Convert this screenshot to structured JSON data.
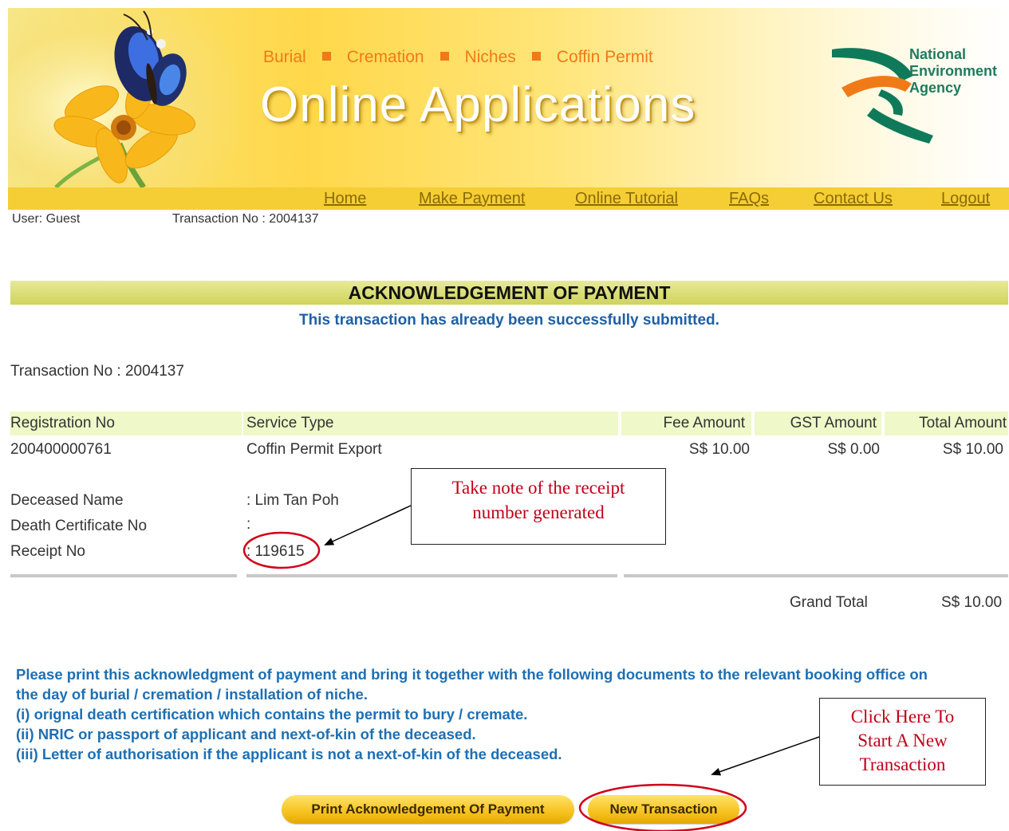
{
  "banner": {
    "subnav": [
      "Burial",
      "Cremation",
      "Niches",
      "Coffin Permit"
    ],
    "title": "Online Applications",
    "agency_lines": [
      "National",
      "Environment",
      "Agency"
    ]
  },
  "nav": {
    "home": "Home",
    "make_payment": "Make Payment",
    "online_tutorial": "Online Tutorial",
    "faqs": "FAQs",
    "contact_us": "Contact Us",
    "logout": "Logout"
  },
  "status": {
    "user_label": "User: ",
    "user_value": "Guest",
    "transaction_label": "Transaction No : 2004137"
  },
  "acknowledgement": {
    "title": "ACKNOWLEDGEMENT OF PAYMENT",
    "message": "This transaction has already been successfully submitted.",
    "transaction_line": "Transaction No : 2004137"
  },
  "table": {
    "headers": [
      "Registration No",
      "Service Type",
      "Fee Amount",
      "GST Amount",
      "Total Amount"
    ],
    "row": [
      "200400000761",
      "Coffin Permit Export",
      "S$ 10.00",
      "S$ 0.00",
      "S$ 10.00"
    ]
  },
  "details": {
    "deceased_label": "Deceased Name",
    "deceased_value": ": Lim Tan Poh",
    "death_cert_label": "Death Certificate No",
    "death_cert_value": ":",
    "receipt_label": "Receipt No",
    "receipt_value": ": 119615"
  },
  "totals": {
    "grand_label": "Grand Total",
    "grand_value": "S$ 10.00"
  },
  "notes": [
    "Please print this acknowledgment of payment and bring it together with the following documents to the relevant booking office on",
    "the day of burial / cremation / installation of niche.",
    "(i) orignal death certification which contains the permit to bury / cremate.",
    "(ii) NRIC or passport of applicant and next-of-kin of the deceased.",
    "(iii) Letter of authorisation if the applicant is not a next-of-kin of the deceased."
  ],
  "buttons": {
    "print": "Print Acknowledgement Of Payment",
    "new_transaction": "New Transaction"
  },
  "annotations": {
    "receipt_note_lines": [
      "Take note of the receipt",
      "number generated"
    ],
    "new_txn_note_lines": [
      "Click Here To",
      "Start A New",
      "Transaction"
    ],
    "highlight_color": "#d0001a"
  },
  "colors": {
    "banner_yellow": "#ffd84a",
    "nav_yellow": "#f5cd35",
    "link_blue": "#1e6fb3",
    "subnav_orange": "#f07a18",
    "agency_green": "#1f7a5e"
  }
}
